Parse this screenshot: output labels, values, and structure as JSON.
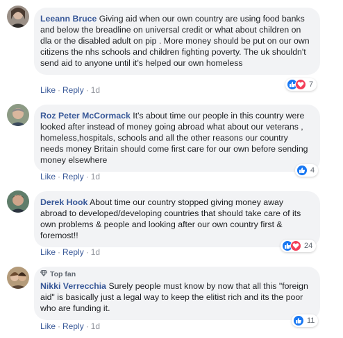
{
  "colors": {
    "link": "#385898",
    "like": "#1877f2",
    "love": "#f33e58",
    "bubble": "#f2f3f5"
  },
  "comments": [
    {
      "author": "Leeann Bruce",
      "text": "Giving aid when our own country are using food banks and below the breadline on universal credit or what about children on dla or the disabled adult on pip . More money should be put on our own citizens the nhs schools and children fighting poverty. The uk shouldn't send aid to anyone until it's helped our own homeless",
      "like": "Like",
      "reply": "Reply",
      "time": "1d",
      "reactions": [
        "like-icon",
        "love-icon"
      ],
      "reaction_count": "7"
    },
    {
      "author": "Roz Peter McCormack",
      "text": "It's about time our people in this country were looked after instead of money going abroad what about our veterans , homeless,hospitals, schools and all the other reasons our country needs money Britain should come first care for our own before sending money elsewhere",
      "like": "Like",
      "reply": "Reply",
      "time": "1d",
      "reactions": [
        "like-icon"
      ],
      "reaction_count": "4"
    },
    {
      "author": "Derek Hook",
      "text": "About time our country stopped giving money away abroad to developed/developing countries that should take care of its own problems & people and looking after our own country first & foremost!!",
      "like": "Like",
      "reply": "Reply",
      "time": "1d",
      "reactions": [
        "like-icon",
        "love-icon"
      ],
      "reaction_count": "24"
    },
    {
      "badge": "Top fan",
      "author": "Nikki Verrecchia",
      "text": "Surely people must know by now that all this \"foreign aid\" is basically just a legal way to keep the elitist rich and its the poor who are funding it.",
      "like": "Like",
      "reply": "Reply",
      "time": "1d",
      "reactions": [
        "like-icon"
      ],
      "reaction_count": "11"
    }
  ]
}
